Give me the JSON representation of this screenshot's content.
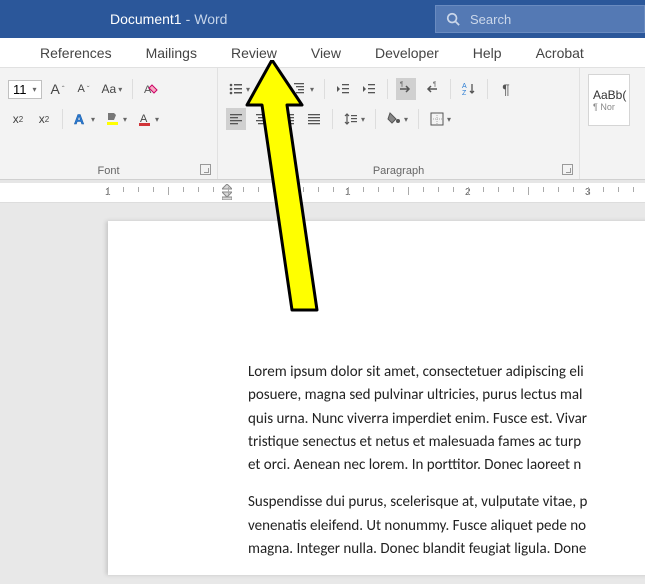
{
  "titlebar": {
    "doc": "Document1",
    "dash": "-",
    "app": "Word",
    "search_placeholder": "Search"
  },
  "tabs": [
    "References",
    "Mailings",
    "Review",
    "View",
    "Developer",
    "Help",
    "Acrobat"
  ],
  "ribbon": {
    "font": {
      "label": "Font",
      "size": "11",
      "grow": "A",
      "shrink": "A",
      "case": "Aa",
      "clear": "A",
      "sub": "x₂",
      "sup": "x²"
    },
    "paragraph": {
      "label": "Paragraph"
    },
    "styles": {
      "sample": "AaBb(",
      "name": "¶ Nor"
    }
  },
  "ruler": {
    "marks": [
      "1",
      "1",
      "2",
      "3"
    ]
  },
  "doc": {
    "p1": "Lorem ipsum dolor sit amet, consectetuer adipiscing eli\nposuere, magna sed pulvinar ultricies, purus lectus mal\nquis urna. Nunc viverra imperdiet enim. Fusce est. Vivar\ntristique senectus et netus et malesuada fames ac turp\net orci. Aenean nec lorem. In porttitor. Donec laoreet n",
    "p2": "Suspendisse dui purus, scelerisque at, vulputate vitae, p\nvenenatis eleifend. Ut nonummy. Fusce aliquet pede no\nmagna. Integer nulla. Donec blandit feugiat ligula. Done"
  }
}
